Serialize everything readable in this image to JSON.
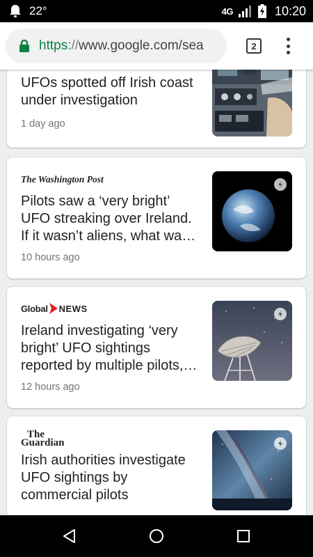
{
  "status_bar": {
    "temperature": "22°",
    "network": "4G",
    "time": "10:20"
  },
  "browser": {
    "url_scheme": "https",
    "url_separator": "://",
    "url_rest": "www.google.com/sea",
    "tab_count": "2"
  },
  "articles": [
    {
      "source": "",
      "title": "UFOs spotted off Irish coast under investigation",
      "time": "1 day ago"
    },
    {
      "source": "The Washington Post",
      "title": "Pilots saw a ‘very bright’ UFO streaking over Ireland. If it wasn’t aliens, what wa…",
      "time": "10 hours ago"
    },
    {
      "source_part1": "Global",
      "source_part2": "NEWS",
      "title": "Ireland investigating ‘very bright’ UFO sightings reported by multiple pilots,…",
      "time": "12 hours ago"
    },
    {
      "source_line1": "The",
      "source_line2": "Guardian",
      "title": "Irish authorities investigate UFO sightings by commercial pilots",
      "time": ""
    }
  ],
  "colors": {
    "accent_green": "#0b8043",
    "global_red": "#e31b23"
  }
}
